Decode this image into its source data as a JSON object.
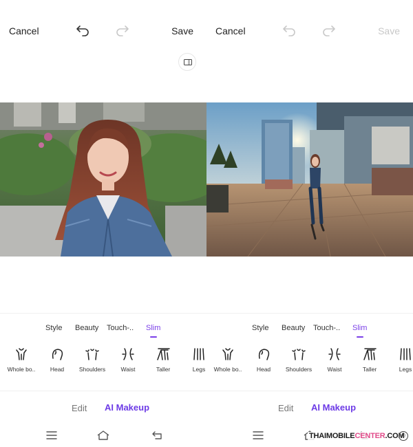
{
  "screens": [
    {
      "id": "before",
      "cancel": "Cancel",
      "save": "Save",
      "save_enabled": true,
      "undo_enabled": true,
      "redo_enabled": false,
      "show_compare": true,
      "photo": "portrait-woman-denim-jacket",
      "tabs": [
        "Style",
        "Beauty",
        "Touch-..",
        "Slim"
      ],
      "active_tab": "Slim",
      "tools": [
        "Whole bo..",
        "Head",
        "Shoulders",
        "Waist",
        "Taller",
        "Legs"
      ],
      "modes": {
        "edit": "Edit",
        "ai_makeup": "AI Makeup"
      }
    },
    {
      "id": "after",
      "cancel": "Cancel",
      "save": "Save",
      "save_enabled": false,
      "undo_enabled": false,
      "redo_enabled": false,
      "show_compare": false,
      "photo": "woman-standing-city-plaza-sunset",
      "tabs": [
        "Style",
        "Beauty",
        "Touch-..",
        "Slim"
      ],
      "active_tab": "Slim",
      "tools": [
        "Whole bo..",
        "Head",
        "Shoulders",
        "Waist",
        "Taller",
        "Legs"
      ],
      "modes": {
        "edit": "Edit",
        "ai_makeup": "AI Makeup"
      }
    }
  ],
  "icons": {
    "undo": "undo-arrow-icon",
    "redo": "redo-arrow-icon",
    "compare": "compare-split-icon",
    "nav": [
      "menu-icon",
      "home-icon",
      "back-icon"
    ],
    "tools": [
      "whole-body-icon",
      "head-icon",
      "shoulders-icon",
      "waist-icon",
      "taller-icon",
      "legs-icon"
    ]
  },
  "watermark": {
    "prefix": "THAIMOBILE",
    "accent": "CENTER",
    "suffix": ".COM",
    "symbol": "©"
  },
  "colors": {
    "accent": "#7a3ee8",
    "ai_makeup": "#6d3be6",
    "disabled": "#c8c8c8",
    "watermark_accent": "#e14b8a"
  }
}
